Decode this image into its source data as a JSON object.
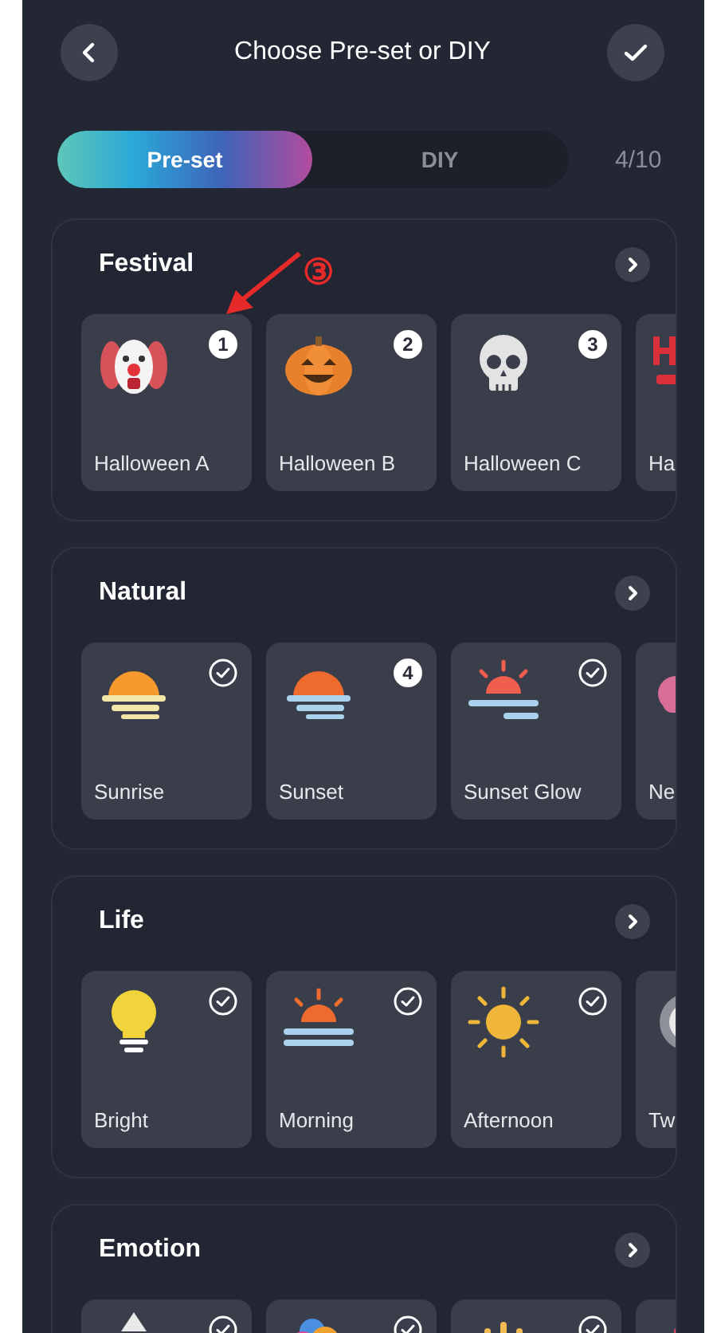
{
  "header": {
    "title": "Choose Pre-set or DIY"
  },
  "tabs": [
    {
      "label": "Pre-set",
      "selected": true
    },
    {
      "label": "DIY",
      "selected": false
    }
  ],
  "count": "4/10",
  "annotation": {
    "label": "③"
  },
  "sections": [
    {
      "title": "Festival",
      "tiles": [
        {
          "label": "Halloween A",
          "selected": true,
          "order": "1"
        },
        {
          "label": "Halloween B",
          "selected": true,
          "order": "2"
        },
        {
          "label": "Halloween C",
          "selected": true,
          "order": "3"
        },
        {
          "kind": "partial",
          "label": "Ha"
        }
      ]
    },
    {
      "title": "Natural",
      "tiles": [
        {
          "label": "Sunrise",
          "selected": false
        },
        {
          "label": "Sunset",
          "selected": true,
          "order": "4"
        },
        {
          "label": "Sunset Glow",
          "selected": false
        },
        {
          "kind": "partial",
          "label": "Ne"
        }
      ]
    },
    {
      "title": "Life",
      "tiles": [
        {
          "label": "Bright",
          "selected": false
        },
        {
          "label": "Morning",
          "selected": false
        },
        {
          "label": "Afternoon",
          "selected": false
        },
        {
          "kind": "partial",
          "label": "Tw"
        }
      ]
    },
    {
      "title": "Emotion",
      "tiles": [
        {
          "selected": false
        },
        {
          "selected": false
        },
        {
          "selected": false
        },
        {
          "kind": "partial"
        }
      ]
    }
  ]
}
